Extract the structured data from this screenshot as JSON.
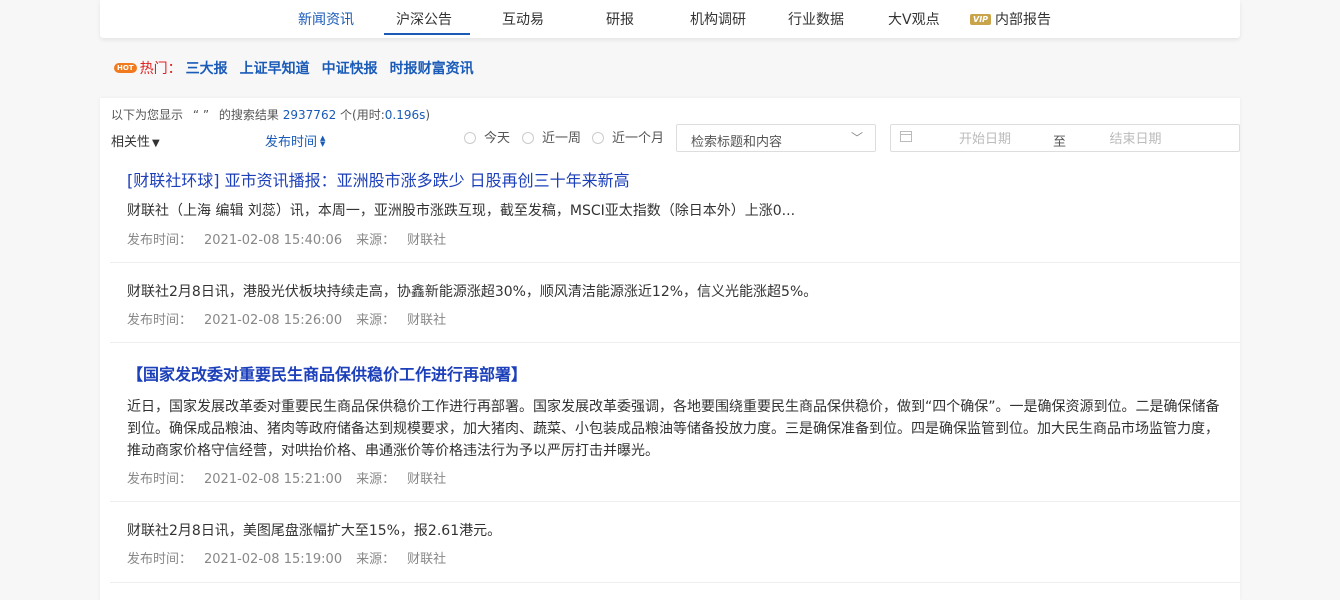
{
  "nav": {
    "tabs": [
      {
        "label": "新闻资讯"
      },
      {
        "label": "沪深公告"
      },
      {
        "label": "互动易"
      },
      {
        "label": "研报"
      },
      {
        "label": "机构调研"
      },
      {
        "label": "行业数据"
      },
      {
        "label": "大V观点"
      },
      {
        "label": "内部报告",
        "badge": "VIP"
      }
    ]
  },
  "hot": {
    "badge": "HOT",
    "label": "热门：",
    "links": [
      "三大报",
      "上证早知道",
      "中证快报",
      "时报财富资讯"
    ]
  },
  "search": {
    "prefix": "以下为您显示",
    "query": "“ ”",
    "middle": "的搜索结果",
    "count": "2937762",
    "unit": "个(用时:",
    "time": "0.196s",
    "suffix": ")"
  },
  "sort": {
    "relevance": "相关性",
    "relevance_icon": "caret-down-icon",
    "publish_time": "发布时间",
    "publish_icon": "sort-icon"
  },
  "filters": {
    "ranges": [
      "今天",
      "近一周",
      "近一个月"
    ],
    "scope_selected": "检索标题和内容",
    "date_start_placeholder": "开始日期",
    "date_to": "至",
    "date_end_placeholder": "结束日期"
  },
  "results": [
    {
      "title": "[财联社环球] 亚市资讯播报：亚洲股市涨多跌少 日股再创三十年来新高",
      "body": "财联社（上海 编辑 刘蕊）讯，本周一，亚洲股市涨跌互现，截至发稿，MSCI亚太指数（除日本外）上涨0...",
      "time_label": "发布时间：",
      "time": "2021-02-08 15:40:06",
      "source_label": "来源：",
      "source": "财联社"
    },
    {
      "title": "",
      "body": "财联社2月8日讯，港股光伏板块持续走高，协鑫新能源涨超30%，顺风清洁能源涨近12%，信义光能涨超5%。",
      "time_label": "发布时间：",
      "time": "2021-02-08 15:26:00",
      "source_label": "来源：",
      "source": "财联社"
    },
    {
      "title": "【国家发改委对重要民生商品保供稳价工作进行再部署】",
      "body": "近日，国家发展改革委对重要民生商品保供稳价工作进行再部署。国家发展改革委强调，各地要围绕重要民生商品保供稳价，做到“四个确保”。一是确保资源到位。二是确保储备到位。确保成品粮油、猪肉等政府储备达到规模要求，加大猪肉、蔬菜、小包装成品粮油等储备投放力度。三是确保准备到位。四是确保监管到位。加大民生商品市场监管力度，推动商家价格守信经营，对哄抬价格、串通涨价等价格违法行为予以严厉打击并曝光。",
      "time_label": "发布时间：",
      "time": "2021-02-08 15:21:00",
      "source_label": "来源：",
      "source": "财联社"
    },
    {
      "title": "",
      "body": "财联社2月8日讯，美图尾盘涨幅扩大至15%，报2.61港元。",
      "time_label": "发布时间：",
      "time": "2021-02-08 15:19:00",
      "source_label": "来源：",
      "source": "财联社"
    }
  ]
}
